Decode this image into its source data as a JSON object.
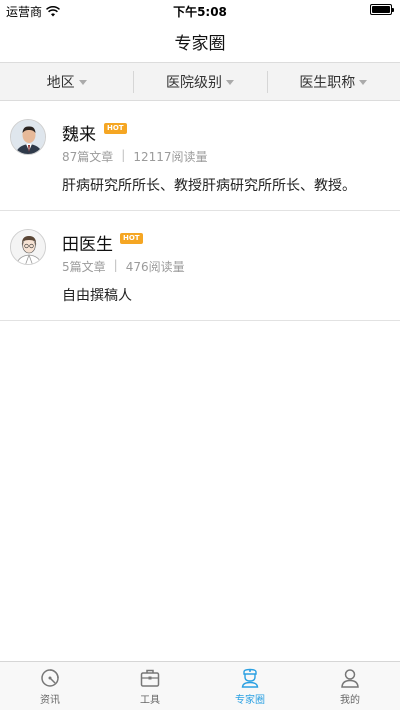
{
  "status_bar": {
    "carrier": "运营商",
    "time": "下午5:08"
  },
  "nav": {
    "title": "专家圈"
  },
  "filters": [
    {
      "label": "地区"
    },
    {
      "label": "医院级别"
    },
    {
      "label": "医生职称"
    }
  ],
  "experts": [
    {
      "name": "魏来",
      "badge": "HOT",
      "articles": "87篇文章",
      "reads": "12117阅读量",
      "bio": "肝病研究所所长、教授肝病研究所所长、教授。"
    },
    {
      "name": "田医生",
      "badge": "HOT",
      "articles": "5篇文章",
      "reads": "476阅读量",
      "bio": "自由撰稿人"
    }
  ],
  "tabs": [
    {
      "label": "资讯",
      "icon": "news-icon"
    },
    {
      "label": "工具",
      "icon": "toolbox-icon"
    },
    {
      "label": "专家圈",
      "icon": "doctor-icon"
    },
    {
      "label": "我的",
      "icon": "user-icon"
    }
  ],
  "colors": {
    "accent": "#2aa0e2",
    "hot_badge": "#f5a623",
    "filter_bg": "#f3f3f3"
  }
}
